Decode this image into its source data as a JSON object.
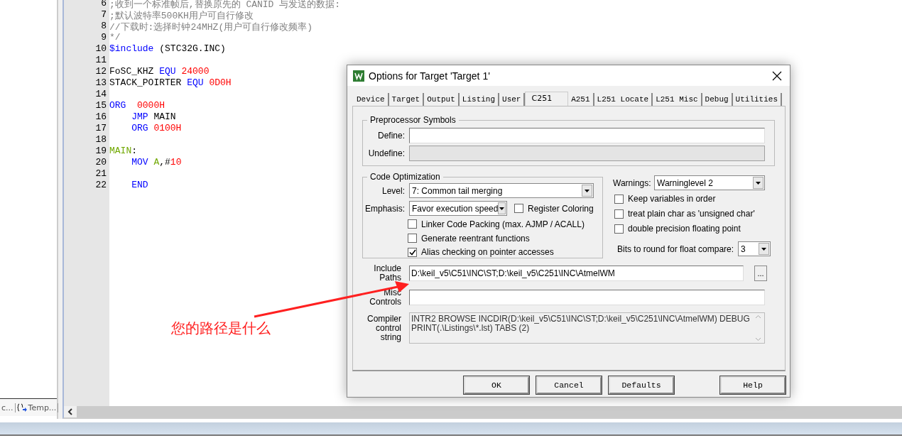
{
  "left_panel": {
    "tabs": [
      {
        "label": "c...",
        "kind": "plain"
      },
      {
        "label": "Temp...",
        "kind": "template"
      }
    ]
  },
  "editor": {
    "lines": [
      {
        "number": "6",
        "tokens": [
          {
            "text": ";收到一个标准帧后,替换原先的 CANID 与发送的数据:",
            "kind": "comment"
          }
        ]
      },
      {
        "number": "7",
        "tokens": [
          {
            "text": ";默认波特率500KH用户可自行修改",
            "kind": "comment"
          }
        ]
      },
      {
        "number": "8",
        "tokens": [
          {
            "text": "//下载时:选择时钟24MHZ(用户可自行修改频率)",
            "kind": "comment"
          }
        ]
      },
      {
        "number": "9",
        "tokens": [
          {
            "text": "*/",
            "kind": "comment"
          }
        ]
      },
      {
        "number": "10",
        "tokens": [
          {
            "text": "$include",
            "kind": "keyword"
          },
          {
            "text": " (STC32G.INC)",
            "kind": "plain"
          }
        ]
      },
      {
        "number": "11"
      },
      {
        "number": "12",
        "tokens": [
          {
            "text": "FoSC_KHZ ",
            "kind": "plain"
          },
          {
            "text": "EQU",
            "kind": "keyword"
          },
          {
            "text": " 24000",
            "kind": "number"
          }
        ]
      },
      {
        "number": "13",
        "tokens": [
          {
            "text": "STACK_POIRTER ",
            "kind": "plain"
          },
          {
            "text": "EQU",
            "kind": "keyword"
          },
          {
            "text": " 0D0H",
            "kind": "number"
          }
        ]
      },
      {
        "number": "14"
      },
      {
        "number": "15",
        "tokens": [
          {
            "text": "ORG",
            "kind": "keyword"
          },
          {
            "text": "  0000H",
            "kind": "number"
          }
        ]
      },
      {
        "number": "16",
        "tokens": [
          {
            "text": "    JMP",
            "kind": "keyword"
          },
          {
            "text": " MAIN",
            "kind": "plain"
          }
        ]
      },
      {
        "number": "17",
        "tokens": [
          {
            "text": "    ORG",
            "kind": "keyword"
          },
          {
            "text": " 0100H",
            "kind": "number"
          }
        ]
      },
      {
        "number": "18"
      },
      {
        "number": "19",
        "tokens": [
          {
            "text": "MAIN",
            "kind": "label"
          },
          {
            "text": ":",
            "kind": "plain"
          }
        ]
      },
      {
        "number": "20",
        "tokens": [
          {
            "text": "    MOV",
            "kind": "keyword"
          },
          {
            "text": " A",
            "kind": "label"
          },
          {
            "text": ",#",
            "kind": "plain"
          },
          {
            "text": "10",
            "kind": "number"
          }
        ]
      },
      {
        "number": "21"
      },
      {
        "number": "22",
        "tokens": [
          {
            "text": "    END",
            "kind": "keyword"
          }
        ]
      }
    ]
  },
  "dialog": {
    "title": "Options for Target 'Target 1'",
    "tabs": [
      {
        "label": "Device",
        "selected": false
      },
      {
        "label": "Target",
        "selected": false
      },
      {
        "label": "Output",
        "selected": false
      },
      {
        "label": "Listing",
        "selected": false
      },
      {
        "label": "User",
        "selected": false
      },
      {
        "label": "C251",
        "selected": true
      },
      {
        "label": "A251",
        "selected": false
      },
      {
        "label": "L251 Locate",
        "selected": false
      },
      {
        "label": "L251 Misc",
        "selected": false
      },
      {
        "label": "Debug",
        "selected": false
      },
      {
        "label": "Utilities",
        "selected": false
      }
    ],
    "preprocessor": {
      "title": "Preprocessor Symbols",
      "fields": [
        {
          "label": "Define:",
          "disabled": false
        },
        {
          "label": "Undefine:",
          "disabled": true
        }
      ]
    },
    "optimization": {
      "title": "Code Optimization",
      "level_label": "Level:",
      "level": "7: Common tail merging",
      "emphasis_label": "Emphasis:",
      "emphasis": "Favor execution speed",
      "register_coloring": {
        "label": "Register Coloring",
        "checked": false
      },
      "options": [
        {
          "label": "Linker Code Packing (max. AJMP / ACALL)",
          "checked": false
        },
        {
          "label": "Generate reentrant functions",
          "checked": false
        },
        {
          "label": "Alias checking on pointer accesses",
          "checked": true
        }
      ]
    },
    "warnings": {
      "label": "Warnings:",
      "value": "Warninglevel 2"
    },
    "right_options": [
      {
        "label": "Keep variables in order",
        "checked": false
      },
      {
        "label": "treat plain char as 'unsigned char'",
        "checked": false
      },
      {
        "label": "double precision floating point",
        "checked": false
      }
    ],
    "float_compare": {
      "label": "Bits to round for float compare:",
      "value": "3"
    },
    "include_paths": {
      "label": "Include Paths",
      "value": "D:\\keil_v5\\C51\\INC\\ST;D:\\keil_v5\\C251\\INC\\AtmelWM",
      "browse": "..."
    },
    "misc_controls": {
      "label": "Misc Controls"
    },
    "compiler_string": {
      "label": "Compiler control string",
      "value": "INTR2 BROWSE INCDIR(D:\\keil_v5\\C51\\INC\\ST;D:\\keil_v5\\C251\\INC\\AtmelWM) DEBUG PRINT(.\\Listings\\*.lst) TABS (2)"
    },
    "buttons": [
      "OK",
      "Cancel",
      "Defaults",
      "Help"
    ]
  },
  "annotation": {
    "text": "您的路径是什么"
  }
}
